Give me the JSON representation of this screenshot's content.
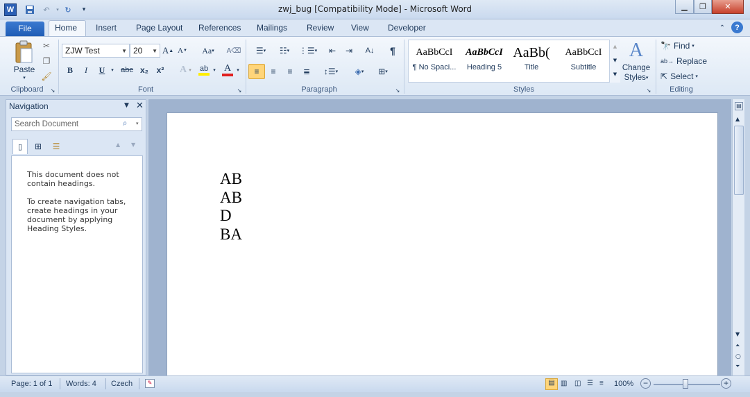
{
  "window": {
    "title": "zwj_bug [Compatibility Mode]  -  Microsoft Word",
    "app_icon": "W",
    "quick_access": [
      "save-icon",
      "undo-icon",
      "redo-icon",
      "customize-icon"
    ]
  },
  "ribbon": {
    "tabs": [
      "File",
      "Home",
      "Insert",
      "Page Layout",
      "References",
      "Mailings",
      "Review",
      "View",
      "Developer"
    ],
    "active_tab": "Home",
    "clipboard": {
      "paste_label": "Paste",
      "group_label": "Clipboard"
    },
    "font": {
      "font_name": "ZJW Test",
      "font_size": "20",
      "change_case": "Aa",
      "bold": "B",
      "italic": "I",
      "underline": "U",
      "strike": "abc",
      "subscript": "x₂",
      "superscript": "x²",
      "highlight": "ab",
      "font_color": "A",
      "group_label": "Font"
    },
    "paragraph": {
      "show_marks": "¶",
      "group_label": "Paragraph"
    },
    "styles": {
      "items": [
        {
          "sample": "AaBbCcI",
          "name": "¶ No Spaci..."
        },
        {
          "sample": "AaBbCcI",
          "name": "Heading 5"
        },
        {
          "sample": "AaBb(",
          "name": "Title"
        },
        {
          "sample": "AaBbCcI",
          "name": "Subtitle"
        }
      ],
      "change_styles_line1": "Change",
      "change_styles_line2": "Styles",
      "group_label": "Styles"
    },
    "editing": {
      "find": "Find",
      "replace": "Replace",
      "select": "Select",
      "group_label": "Editing"
    },
    "accent_color": "#1f5cb4"
  },
  "navigation": {
    "title": "Navigation",
    "search_placeholder": "Search Document",
    "message1": "This document does not contain headings.",
    "message2": "To create navigation tabs, create headings in your document by applying Heading Styles."
  },
  "document": {
    "lines": [
      "AB",
      "AB",
      "D",
      "BA"
    ]
  },
  "statusbar": {
    "page": "Page: 1 of 1",
    "words": "Words: 4",
    "language": "Czech",
    "zoom": "100%",
    "zoom_level_percent": 100
  }
}
